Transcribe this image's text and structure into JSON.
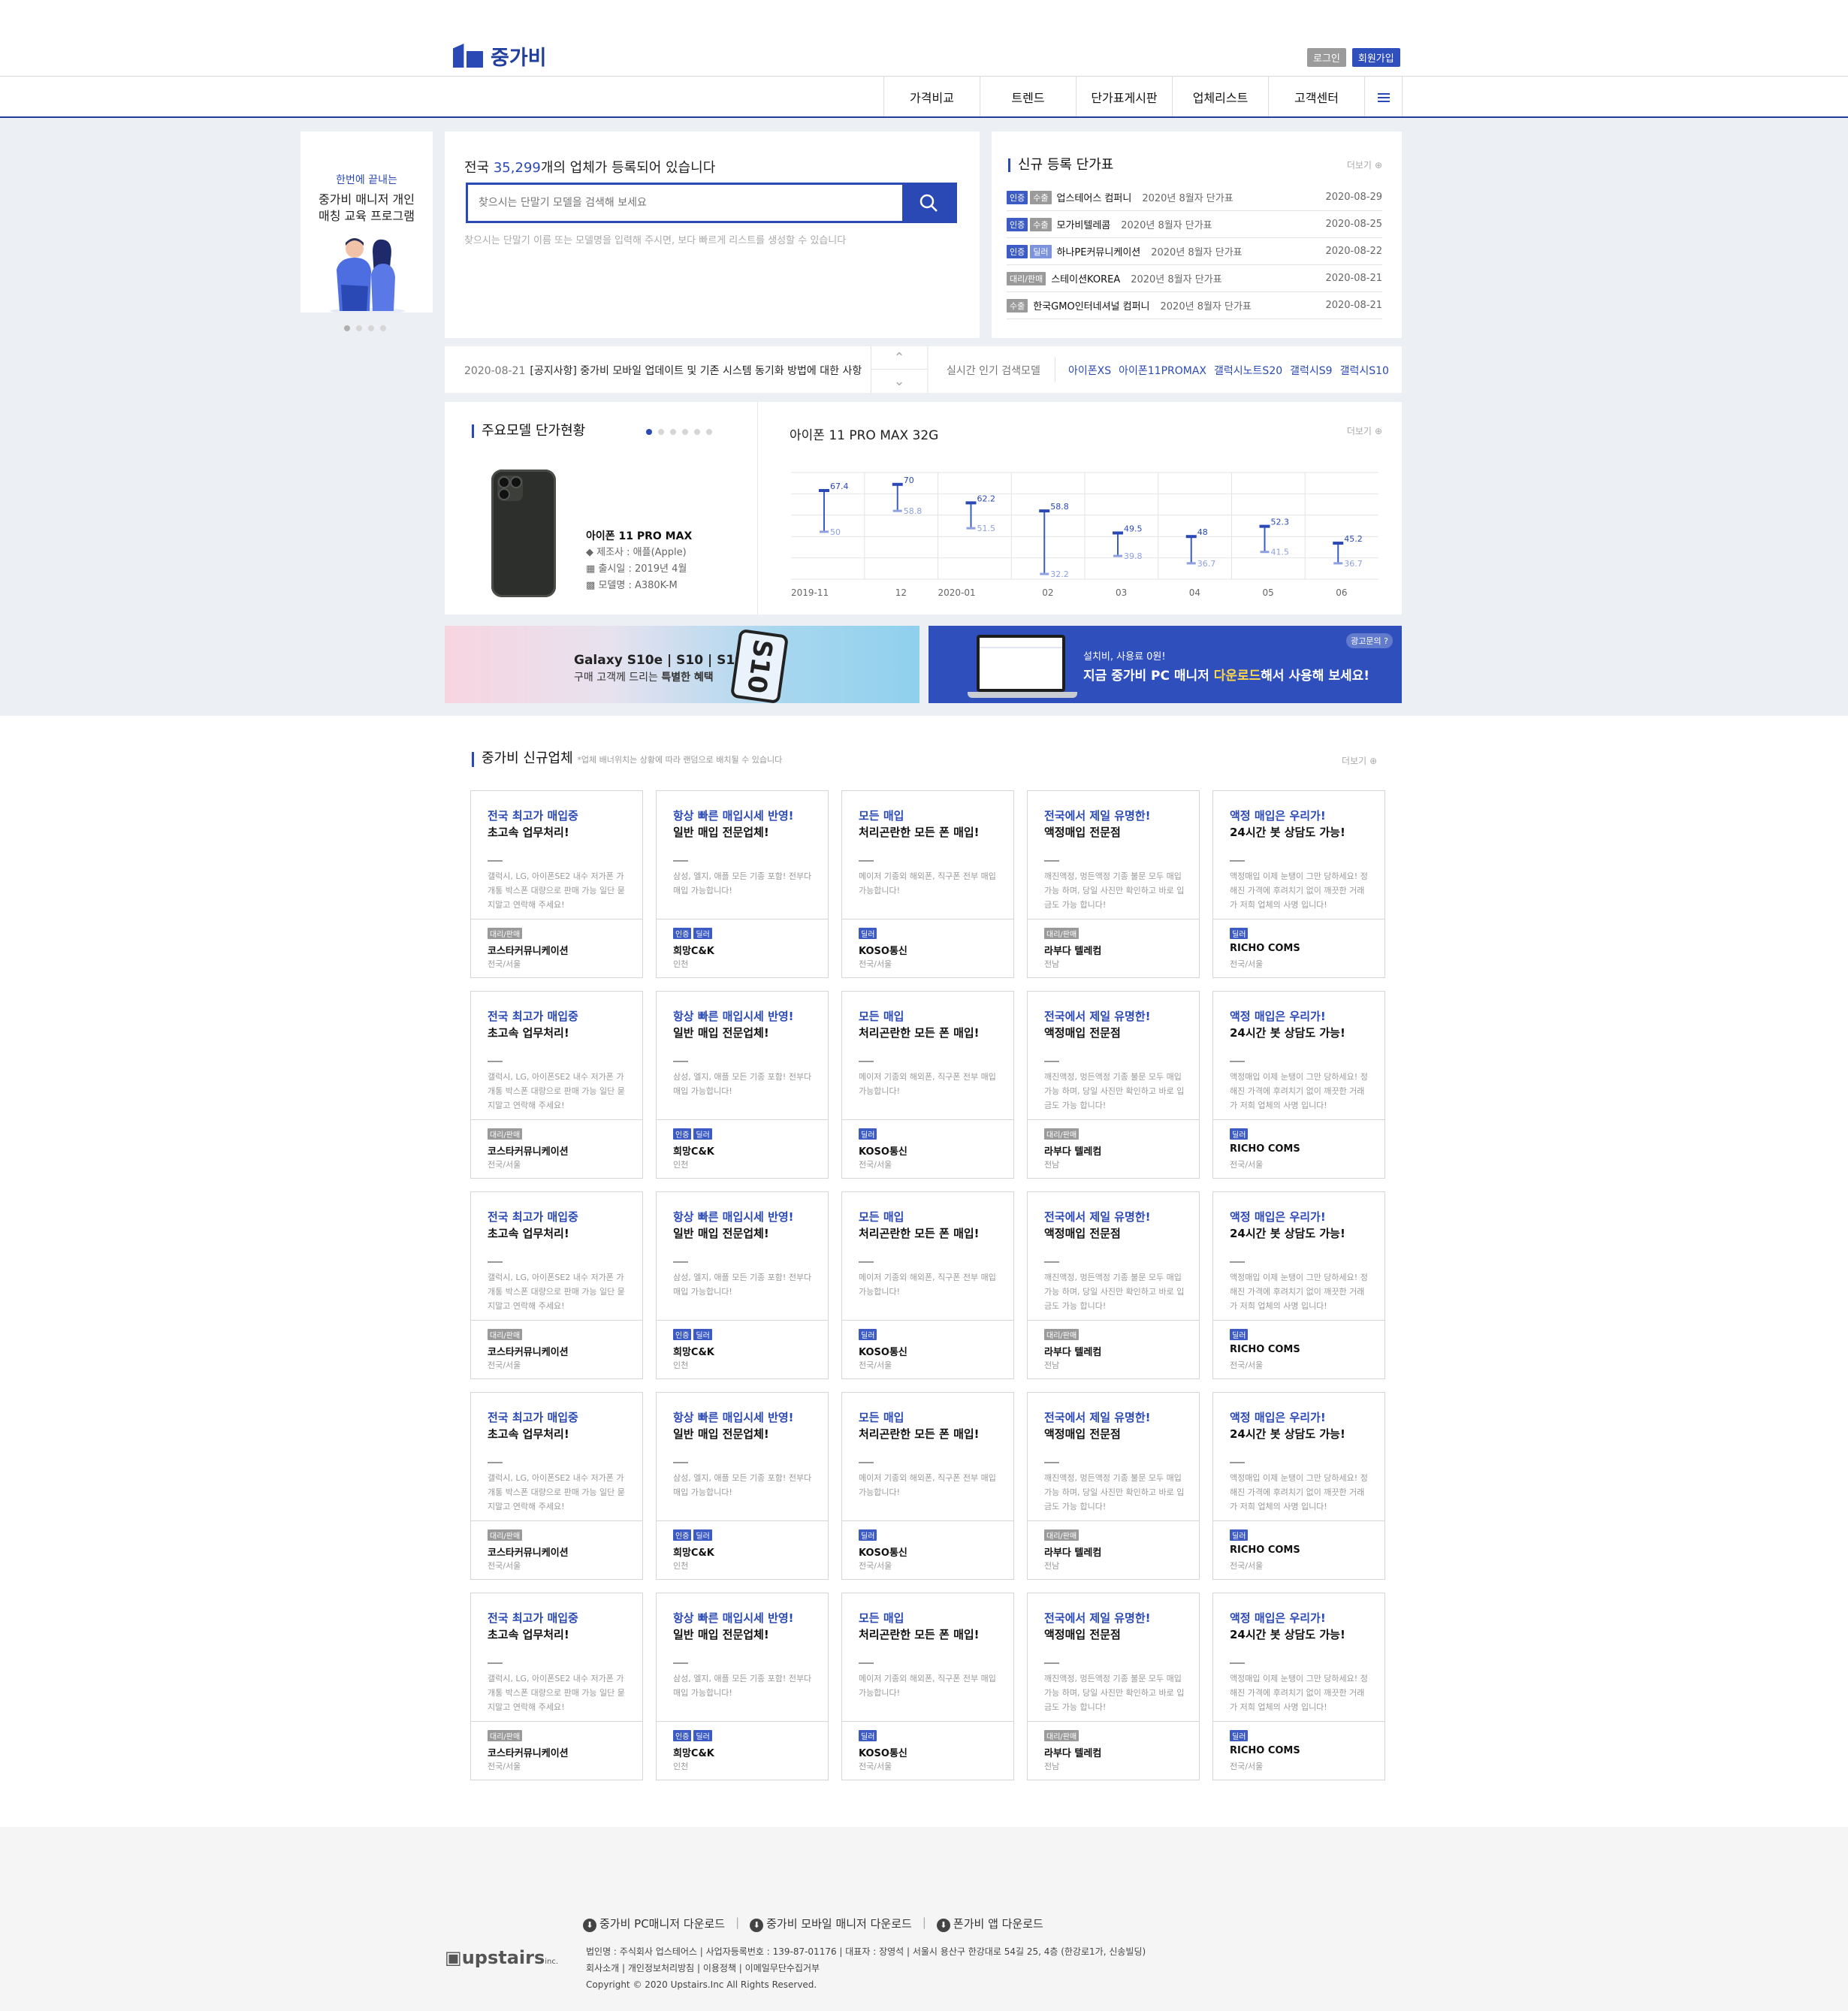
{
  "header": {
    "logo_text": "중가비",
    "login": "로그인",
    "signup": "회원가입",
    "nav": [
      "가격비교",
      "트렌드",
      "단가표게시판",
      "업체리스트",
      "고객센터"
    ]
  },
  "promo": {
    "kicker": "한번에 끝내는",
    "title_1": "중가비 매니저 개인",
    "title_2": "매칭 교육 프로그램"
  },
  "search": {
    "lead_pre": "전국",
    "count": "35,299",
    "lead_post": "개의 업체가 등록되어 있습니다",
    "placeholder": "찾으시는 단말기 모델을 검색해 보세요",
    "hint": "찾으시는 단말기 이름 또는 모델명을 입력해 주시면, 보다 빠르게 리스트를 생성할 수 있습니다"
  },
  "new_price": {
    "title": "신규 등록 단가표",
    "more": "더보기",
    "rows": [
      {
        "badges": [
          "인증",
          "수출"
        ],
        "name": "업스테어스 컴퍼니",
        "sub": "2020년 8월자 단가표",
        "date": "2020-08-29"
      },
      {
        "badges": [
          "인증",
          "수출"
        ],
        "name": "모가비텔레콤",
        "sub": "2020년 8월자 단가표",
        "date": "2020-08-25"
      },
      {
        "badges": [
          "인증",
          "딜러"
        ],
        "name": "하나PE커뮤니케이션",
        "sub": "2020년 8월자 단가표",
        "date": "2020-08-22"
      },
      {
        "badges": [
          "대리/판매"
        ],
        "name": "스테이션KOREA",
        "sub": "2020년 8월자 단가표",
        "date": "2020-08-21"
      },
      {
        "badges": [
          "수출"
        ],
        "name": "한국GMO인터네셔널 컴퍼니",
        "sub": "2020년 8월자 단가표",
        "date": "2020-08-21"
      }
    ]
  },
  "notice": {
    "date": "2020-08-21",
    "text": "[공지사항] 중가비 모바일 업데이트 및 기존 시스템 동기화 방법에 대한 사항"
  },
  "popular": {
    "label": "실시간 인기 검색모델",
    "keywords": [
      "아이폰XS",
      "아이폰11PROMAX",
      "갤럭시노트S20",
      "갤럭시S9",
      "갤럭시S10"
    ]
  },
  "model": {
    "title": "주요모델 단가현황",
    "name": "아이폰 11 PRO MAX",
    "maker": "제조사 : 애플(Apple)",
    "release": "출시일 : 2019년 4월",
    "model_no": "모델명 : A380K-M",
    "chart_title": "아이폰 11 PRO MAX 32G",
    "more": "더보기"
  },
  "chart_data": {
    "type": "range",
    "title": "아이폰 11 PRO MAX 32G",
    "categories": [
      "2019-11",
      "12",
      "2020-01",
      "02",
      "03",
      "04",
      "05",
      "06"
    ],
    "series": [
      {
        "name": "high",
        "values": [
          67.4,
          70,
          62.2,
          58.8,
          49.5,
          48,
          52.3,
          45.2
        ]
      },
      {
        "name": "low",
        "values": [
          50,
          58.8,
          51.5,
          32.2,
          39.8,
          36.7,
          41.5,
          36.7
        ]
      }
    ],
    "ylim": [
      30,
      75
    ],
    "grid": true
  },
  "banner1": {
    "brand": "Galaxy S10e | S10 | S10+",
    "sub_pre": "구매 고객께 드리는 ",
    "sub_bold": "특별한 혜택",
    "phone_text": "S10"
  },
  "banner2": {
    "ad": "광고문의",
    "l1": "설치비, 사용료 0원!",
    "l2_pre": "지금 중가비 PC 매니저 ",
    "l2_hl": "다운로드",
    "l2_post": "해서 사용해 보세요!"
  },
  "vendors": {
    "title": "중가비 신규업체",
    "note": "*업체 배너위치는 상황에 따라 랜덤으로 배치될 수 있습니다",
    "more": "더보기",
    "cards": [
      {
        "h1": "전국 최고가 매입중",
        "h2": "초고속 업무처리!",
        "desc": "갤럭시, LG, 아이폰SE2 내수 저가폰 가개통 박스폰 대량으로 판매 가능 일단 묻지말고 연락해 주세요!",
        "badges": [
          "대리/판매"
        ],
        "name": "코스타커뮤니케이션",
        "region": "전국/서울"
      },
      {
        "h1": "항상 빠른 매입시세 반영!",
        "h2": "일반 매입 전문업체!",
        "desc": "삼성, 엘지, 애플 모든 기종 포함! 전부다 매입 가능합니다!",
        "badges": [
          "인증",
          "딜러"
        ],
        "name": "희망C&K",
        "region": "인천"
      },
      {
        "h1": "모든 매입",
        "h2": "처리곤란한 모든 폰 매입!",
        "desc": "메이저 기종외 해외폰, 직구폰 전부 매입 가능합니다!",
        "badges": [
          "딜러"
        ],
        "name": "KOSO통신",
        "region": "전국/서울"
      },
      {
        "h1": "전국에서 제일 유명한!",
        "h2": "액정매입 전문점",
        "desc": "깨진액정, 멍든액정 기종 불문 모두 매입 가능 하며, 당일 사진만 확인하고 바로 입금도 가능 합니다!",
        "badges": [
          "대리/판매"
        ],
        "name": "라부다 텔레컴",
        "region": "전남"
      },
      {
        "h1": "액정 매입은 우리가!",
        "h2": "24시간 봇 상담도 가능!",
        "desc": "액정매입 이제 눈탱이 그만 당하세요! 정해진 가격에 후려치기 없이 깨끗한 거래가 저희 업체의 사명 입니다!",
        "badges": [
          "딜러"
        ],
        "name": "RICHO COMS",
        "region": "전국/서울"
      }
    ]
  },
  "footer": {
    "downloads": [
      "중가비 PC매니저 다운로드",
      "중가비 모바일 매니저 다운로드",
      "폰가비 앱 다운로드"
    ],
    "logo": "upstairs",
    "logo_suffix": "inc.",
    "corp": "법인명 : 주식회사 업스테어스  |  사업자등록번호 : 139-87-01176  |  대표자 : 장영석  |  서울시 용산구 한강대로 54길 25, 4층 (한강로1가, 신송빌딩)",
    "links": "회사소개  |  개인정보처리방침  |  이용정책  |  이메일무단수집거부",
    "copyright": "Copyright © 2020 Upstairs.Inc All Rights Reserved."
  }
}
